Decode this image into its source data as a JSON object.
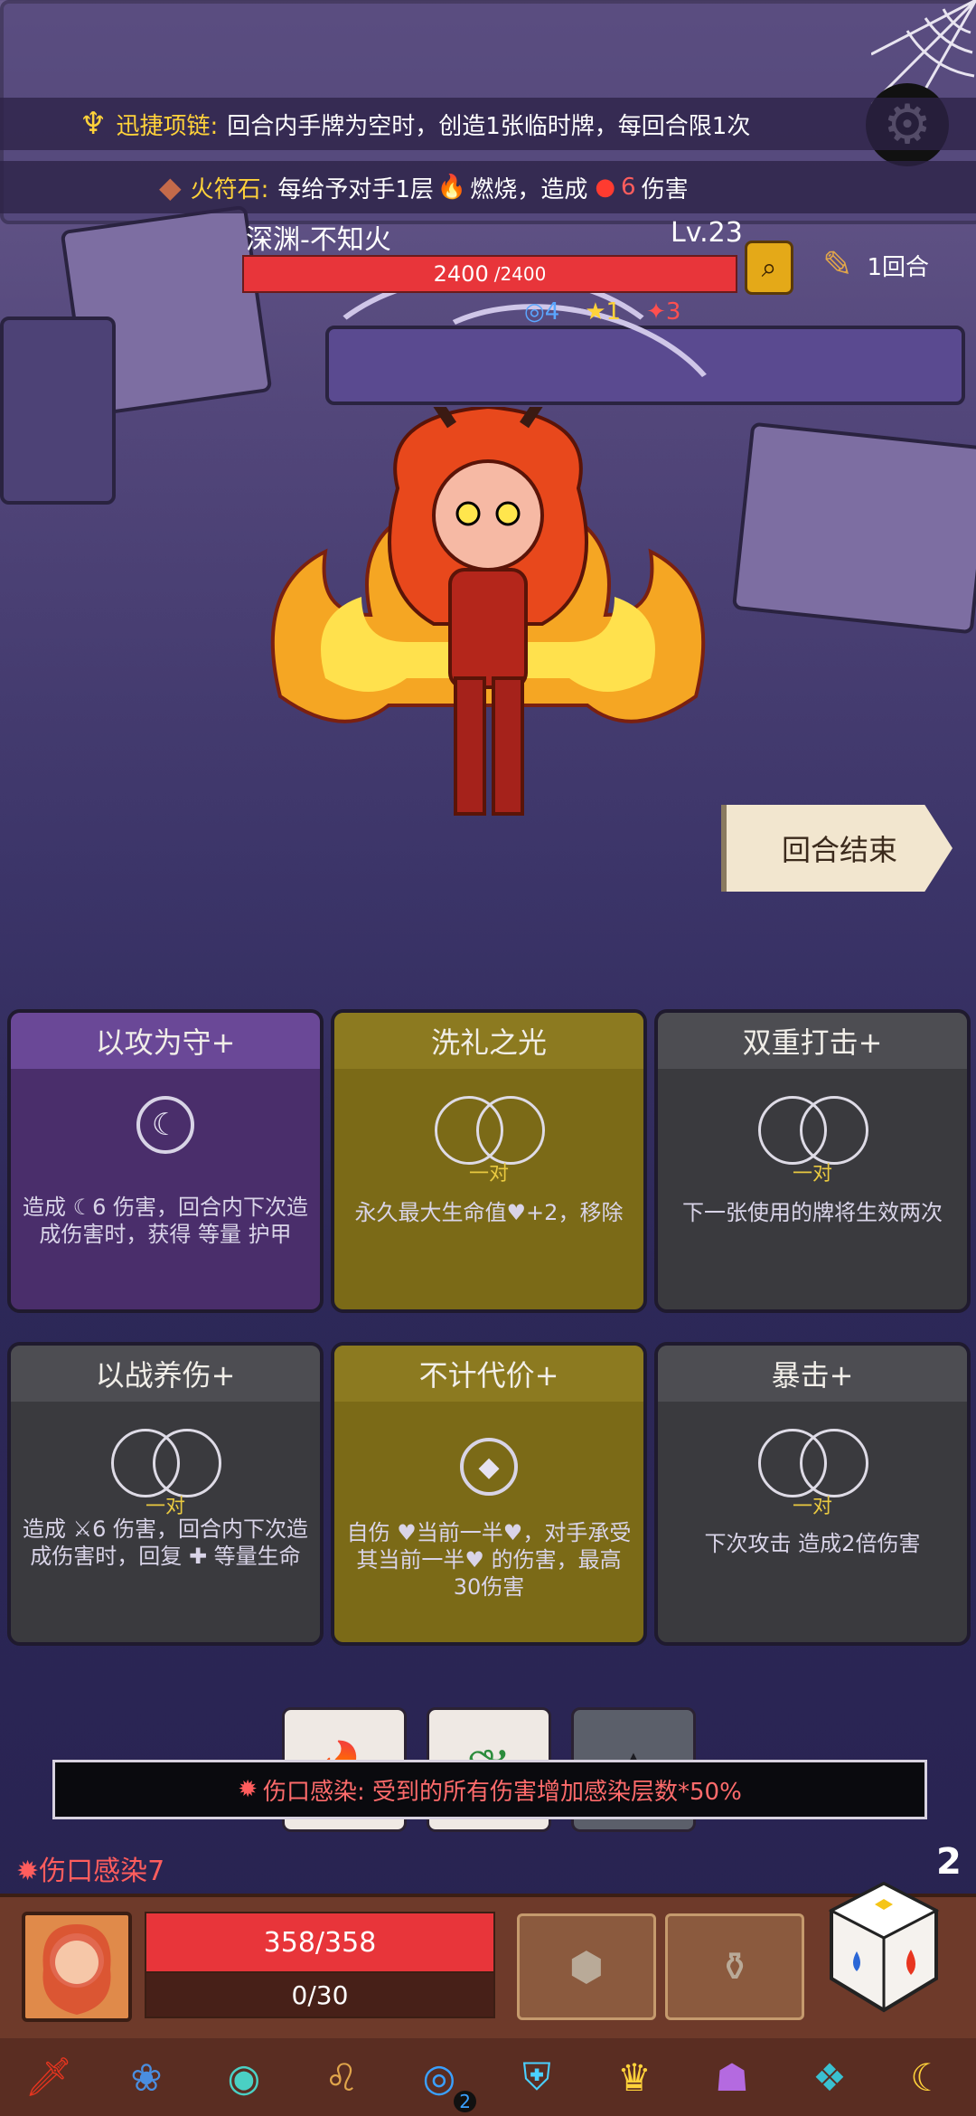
{
  "buffs": [
    {
      "name": "迅捷项链:",
      "text": "回合内手牌为空时，创造1张临时牌，每回合限1次"
    },
    {
      "name": "火符石:",
      "text_a": "每给予对手1层",
      "burn": "燃烧",
      "text_b": "，造成",
      "dmg": "6",
      "text_c": "伤害"
    }
  ],
  "enemy": {
    "name": "深渊-不知火",
    "level": "Lv.23",
    "hp_current": "2400",
    "hp_max": "/2400",
    "turn": "1回合",
    "stats": {
      "shield": "4",
      "star": "1",
      "bird": "3"
    }
  },
  "end_turn_label": "回合结束",
  "cards": [
    {
      "title": "以攻为守+",
      "pair": "",
      "desc": "造成 ☾6 伤害，回合内下次造成伤害时，获得 等量 护甲"
    },
    {
      "title": "洗礼之光",
      "pair": "一对",
      "desc": "永久最大生命值♥+2，移除"
    },
    {
      "title": "双重打击+",
      "pair": "一对",
      "desc": "下一张使用的牌将生效两次"
    },
    {
      "title": "以战养伤+",
      "pair": "一对",
      "desc": "造成 ⚔6 伤害，回合内下次造成伤害时，回复 ✚ 等量生命"
    },
    {
      "title": "不计代价+",
      "pair": "",
      "desc": "自伤 ♥当前一半♥，对手承受其当前一半♥ 的伤害，最高30伤害"
    },
    {
      "title": "暴击+",
      "pair": "一对",
      "desc": "下次攻击 造成2倍伤害"
    }
  ],
  "toast": "伤口感染: 受到的所有伤害增加感染层数*50%",
  "status_effect": "伤口感染7",
  "dice_count": "2",
  "player": {
    "hp": "358/358",
    "shield": "0/30"
  },
  "relic_badge": "2",
  "colors": {
    "enemy_hp": "#e8353a",
    "gold": "#ffd23a",
    "status": "#ff5d5d"
  }
}
